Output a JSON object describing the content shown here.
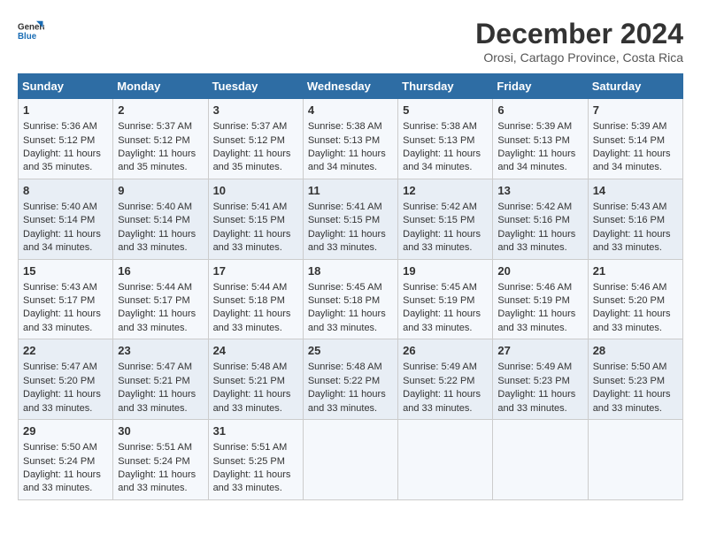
{
  "logo": {
    "line1": "General",
    "line2": "Blue"
  },
  "title": "December 2024",
  "subtitle": "Orosi, Cartago Province, Costa Rica",
  "days_of_week": [
    "Sunday",
    "Monday",
    "Tuesday",
    "Wednesday",
    "Thursday",
    "Friday",
    "Saturday"
  ],
  "weeks": [
    [
      {
        "day": "1",
        "sunrise": "5:36 AM",
        "sunset": "5:12 PM",
        "daylight": "11 hours and 35 minutes."
      },
      {
        "day": "2",
        "sunrise": "5:37 AM",
        "sunset": "5:12 PM",
        "daylight": "11 hours and 35 minutes."
      },
      {
        "day": "3",
        "sunrise": "5:37 AM",
        "sunset": "5:12 PM",
        "daylight": "11 hours and 35 minutes."
      },
      {
        "day": "4",
        "sunrise": "5:38 AM",
        "sunset": "5:13 PM",
        "daylight": "11 hours and 34 minutes."
      },
      {
        "day": "5",
        "sunrise": "5:38 AM",
        "sunset": "5:13 PM",
        "daylight": "11 hours and 34 minutes."
      },
      {
        "day": "6",
        "sunrise": "5:39 AM",
        "sunset": "5:13 PM",
        "daylight": "11 hours and 34 minutes."
      },
      {
        "day": "7",
        "sunrise": "5:39 AM",
        "sunset": "5:14 PM",
        "daylight": "11 hours and 34 minutes."
      }
    ],
    [
      {
        "day": "8",
        "sunrise": "5:40 AM",
        "sunset": "5:14 PM",
        "daylight": "11 hours and 34 minutes."
      },
      {
        "day": "9",
        "sunrise": "5:40 AM",
        "sunset": "5:14 PM",
        "daylight": "11 hours and 33 minutes."
      },
      {
        "day": "10",
        "sunrise": "5:41 AM",
        "sunset": "5:15 PM",
        "daylight": "11 hours and 33 minutes."
      },
      {
        "day": "11",
        "sunrise": "5:41 AM",
        "sunset": "5:15 PM",
        "daylight": "11 hours and 33 minutes."
      },
      {
        "day": "12",
        "sunrise": "5:42 AM",
        "sunset": "5:15 PM",
        "daylight": "11 hours and 33 minutes."
      },
      {
        "day": "13",
        "sunrise": "5:42 AM",
        "sunset": "5:16 PM",
        "daylight": "11 hours and 33 minutes."
      },
      {
        "day": "14",
        "sunrise": "5:43 AM",
        "sunset": "5:16 PM",
        "daylight": "11 hours and 33 minutes."
      }
    ],
    [
      {
        "day": "15",
        "sunrise": "5:43 AM",
        "sunset": "5:17 PM",
        "daylight": "11 hours and 33 minutes."
      },
      {
        "day": "16",
        "sunrise": "5:44 AM",
        "sunset": "5:17 PM",
        "daylight": "11 hours and 33 minutes."
      },
      {
        "day": "17",
        "sunrise": "5:44 AM",
        "sunset": "5:18 PM",
        "daylight": "11 hours and 33 minutes."
      },
      {
        "day": "18",
        "sunrise": "5:45 AM",
        "sunset": "5:18 PM",
        "daylight": "11 hours and 33 minutes."
      },
      {
        "day": "19",
        "sunrise": "5:45 AM",
        "sunset": "5:19 PM",
        "daylight": "11 hours and 33 minutes."
      },
      {
        "day": "20",
        "sunrise": "5:46 AM",
        "sunset": "5:19 PM",
        "daylight": "11 hours and 33 minutes."
      },
      {
        "day": "21",
        "sunrise": "5:46 AM",
        "sunset": "5:20 PM",
        "daylight": "11 hours and 33 minutes."
      }
    ],
    [
      {
        "day": "22",
        "sunrise": "5:47 AM",
        "sunset": "5:20 PM",
        "daylight": "11 hours and 33 minutes."
      },
      {
        "day": "23",
        "sunrise": "5:47 AM",
        "sunset": "5:21 PM",
        "daylight": "11 hours and 33 minutes."
      },
      {
        "day": "24",
        "sunrise": "5:48 AM",
        "sunset": "5:21 PM",
        "daylight": "11 hours and 33 minutes."
      },
      {
        "day": "25",
        "sunrise": "5:48 AM",
        "sunset": "5:22 PM",
        "daylight": "11 hours and 33 minutes."
      },
      {
        "day": "26",
        "sunrise": "5:49 AM",
        "sunset": "5:22 PM",
        "daylight": "11 hours and 33 minutes."
      },
      {
        "day": "27",
        "sunrise": "5:49 AM",
        "sunset": "5:23 PM",
        "daylight": "11 hours and 33 minutes."
      },
      {
        "day": "28",
        "sunrise": "5:50 AM",
        "sunset": "5:23 PM",
        "daylight": "11 hours and 33 minutes."
      }
    ],
    [
      {
        "day": "29",
        "sunrise": "5:50 AM",
        "sunset": "5:24 PM",
        "daylight": "11 hours and 33 minutes."
      },
      {
        "day": "30",
        "sunrise": "5:51 AM",
        "sunset": "5:24 PM",
        "daylight": "11 hours and 33 minutes."
      },
      {
        "day": "31",
        "sunrise": "5:51 AM",
        "sunset": "5:25 PM",
        "daylight": "11 hours and 33 minutes."
      },
      null,
      null,
      null,
      null
    ]
  ],
  "labels": {
    "sunrise": "Sunrise:",
    "sunset": "Sunset:",
    "daylight": "Daylight:"
  }
}
